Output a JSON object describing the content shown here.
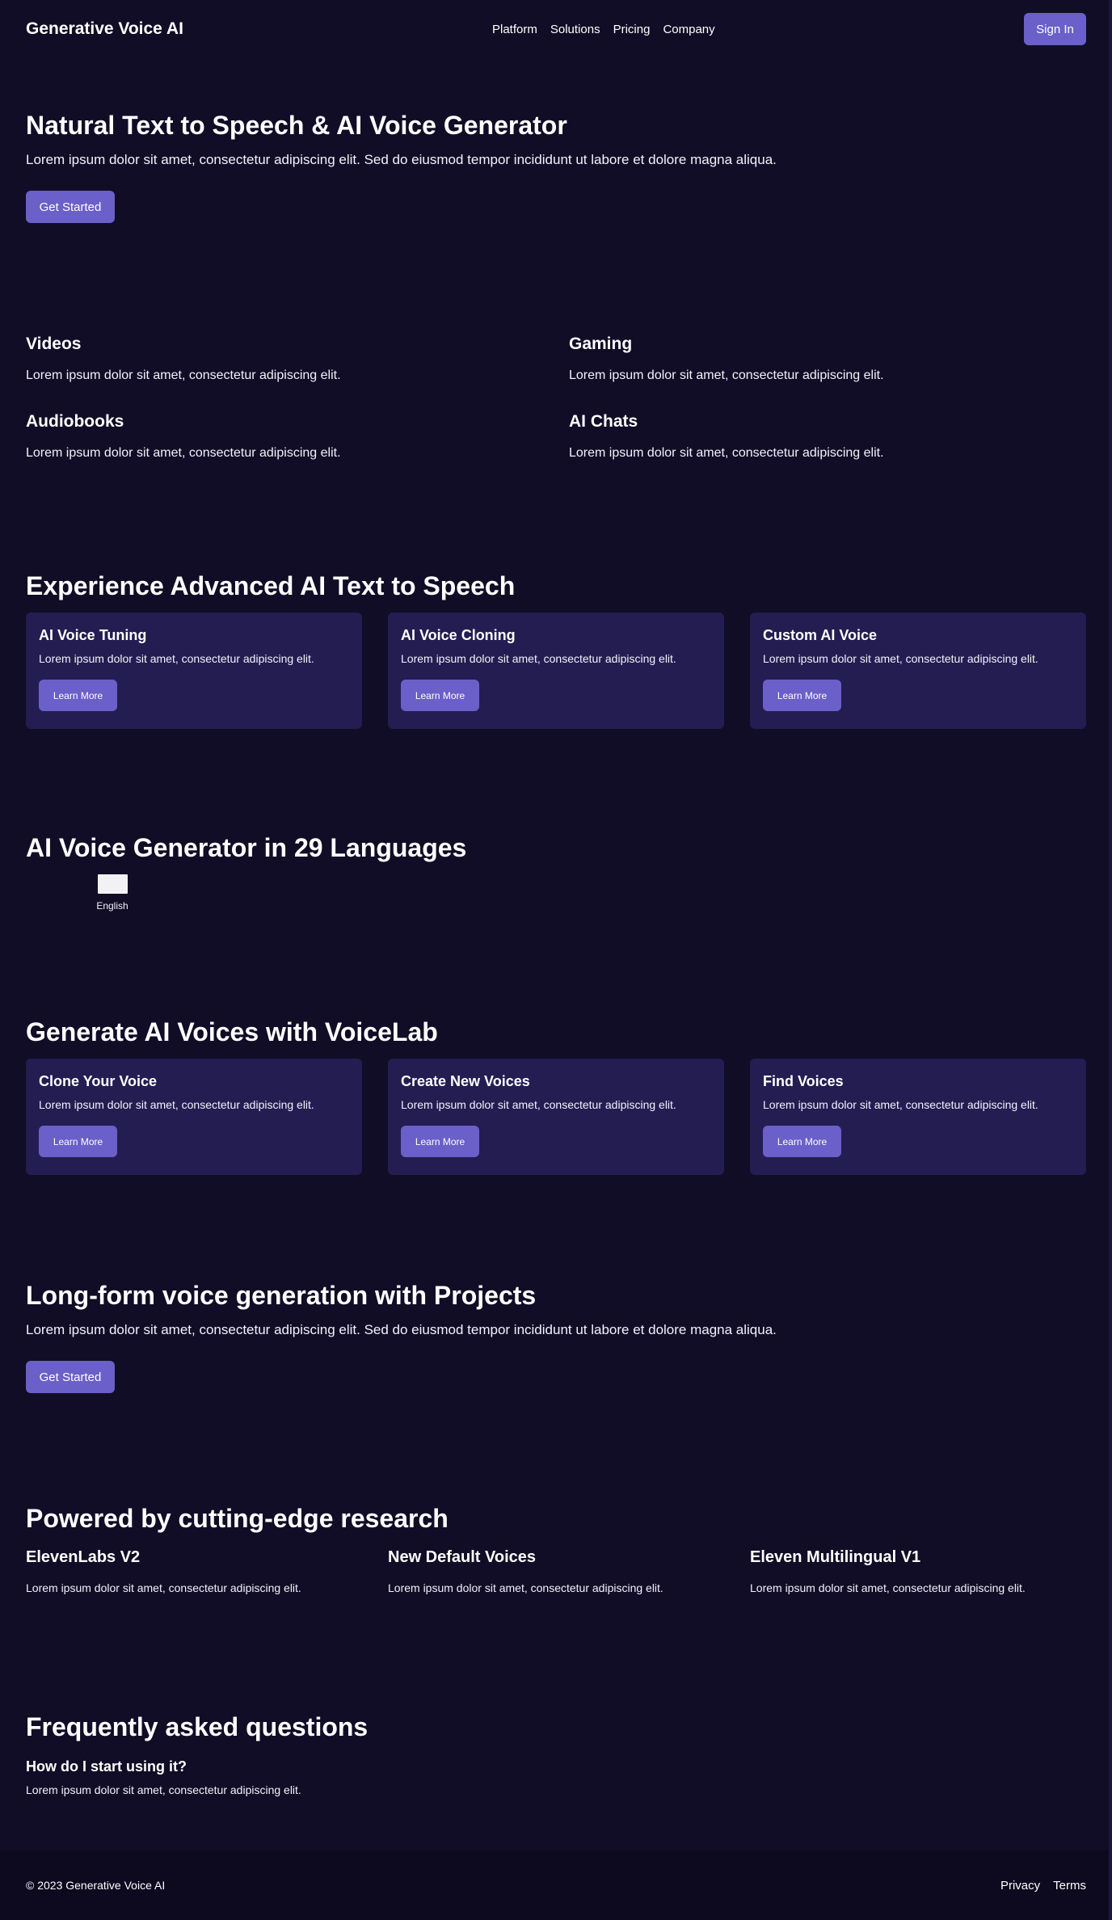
{
  "header": {
    "brand": "Generative Voice AI",
    "nav": [
      "Platform",
      "Solutions",
      "Pricing",
      "Company"
    ],
    "sign_in": "Sign In"
  },
  "hero": {
    "title": "Natural Text to Speech & AI Voice Generator",
    "text": "Lorem ipsum dolor sit amet, consectetur adipiscing elit. Sed do eiusmod tempor incididunt ut labore et dolore magna aliqua.",
    "cta": "Get Started"
  },
  "usecases": [
    {
      "title": "Videos",
      "text": "Lorem ipsum dolor sit amet, consectetur adipiscing elit."
    },
    {
      "title": "Gaming",
      "text": "Lorem ipsum dolor sit amet, consectetur adipiscing elit."
    },
    {
      "title": "Audiobooks",
      "text": "Lorem ipsum dolor sit amet, consectetur adipiscing elit."
    },
    {
      "title": "AI Chats",
      "text": "Lorem ipsum dolor sit amet, consectetur adipiscing elit."
    }
  ],
  "advanced": {
    "title": "Experience Advanced AI Text to Speech",
    "cards": [
      {
        "title": "AI Voice Tuning",
        "text": "Lorem ipsum dolor sit amet, consectetur adipiscing elit.",
        "button": "Learn More"
      },
      {
        "title": "AI Voice Cloning",
        "text": "Lorem ipsum dolor sit amet, consectetur adipiscing elit.",
        "button": "Learn More"
      },
      {
        "title": "Custom AI Voice",
        "text": "Lorem ipsum dolor sit amet, consectetur adipiscing elit.",
        "button": "Learn More"
      }
    ]
  },
  "languages": {
    "title": "AI Voice Generator in 29 Languages",
    "items": [
      {
        "label": "English"
      }
    ]
  },
  "voicelab": {
    "title": "Generate AI Voices with VoiceLab",
    "cards": [
      {
        "title": "Clone Your Voice",
        "text": "Lorem ipsum dolor sit amet, consectetur adipiscing elit.",
        "button": "Learn More"
      },
      {
        "title": "Create New Voices",
        "text": "Lorem ipsum dolor sit amet, consectetur adipiscing elit.",
        "button": "Learn More"
      },
      {
        "title": "Find Voices",
        "text": "Lorem ipsum dolor sit amet, consectetur adipiscing elit.",
        "button": "Learn More"
      }
    ]
  },
  "projects": {
    "title": "Long-form voice generation with Projects",
    "text": "Lorem ipsum dolor sit amet, consectetur adipiscing elit. Sed do eiusmod tempor incididunt ut labore et dolore magna aliqua.",
    "cta": "Get Started"
  },
  "research": {
    "title": "Powered by cutting-edge research",
    "items": [
      {
        "title": "ElevenLabs V2",
        "text": "Lorem ipsum dolor sit amet, consectetur adipiscing elit."
      },
      {
        "title": "New Default Voices",
        "text": "Lorem ipsum dolor sit amet, consectetur adipiscing elit."
      },
      {
        "title": "Eleven Multilingual V1",
        "text": "Lorem ipsum dolor sit amet, consectetur adipiscing elit."
      }
    ]
  },
  "faq": {
    "title": "Frequently asked questions",
    "items": [
      {
        "question": "How do I start using it?",
        "answer": "Lorem ipsum dolor sit amet, consectetur adipiscing elit."
      }
    ]
  },
  "footer": {
    "copyright": "© 2023 Generative Voice AI",
    "links": [
      "Privacy",
      "Terms"
    ]
  },
  "colors": {
    "background": "#110d26",
    "card": "#241d52",
    "accent": "#6b5fc9",
    "footer": "#0d0a1f"
  }
}
